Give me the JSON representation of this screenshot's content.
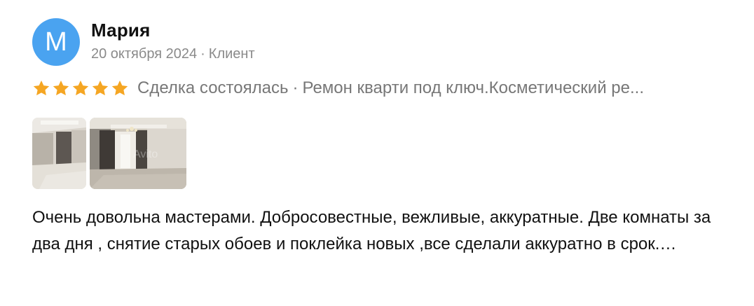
{
  "review": {
    "author": {
      "initial": "М",
      "name": "Мария",
      "date": "20 октября 2024",
      "separator": "·",
      "role": "Клиент"
    },
    "rating": 5,
    "deal_status": "Сделка состоялась",
    "separator": "·",
    "service": "Ремон кварти под ключ.Косметический ре...",
    "photos_watermark": "Avito",
    "text": "Очень довольна мастерами. Добросовестные, вежливые, аккуратные. Две комнаты за два дня , снятие старых обоев и поклейка новых ,все сделали аккуратно в срок.…"
  },
  "colors": {
    "avatar_bg": "#4aa3f0",
    "star": "#f5a623",
    "meta_text": "#8a8a8a",
    "deal_text": "#777777",
    "body_text": "#111111"
  }
}
